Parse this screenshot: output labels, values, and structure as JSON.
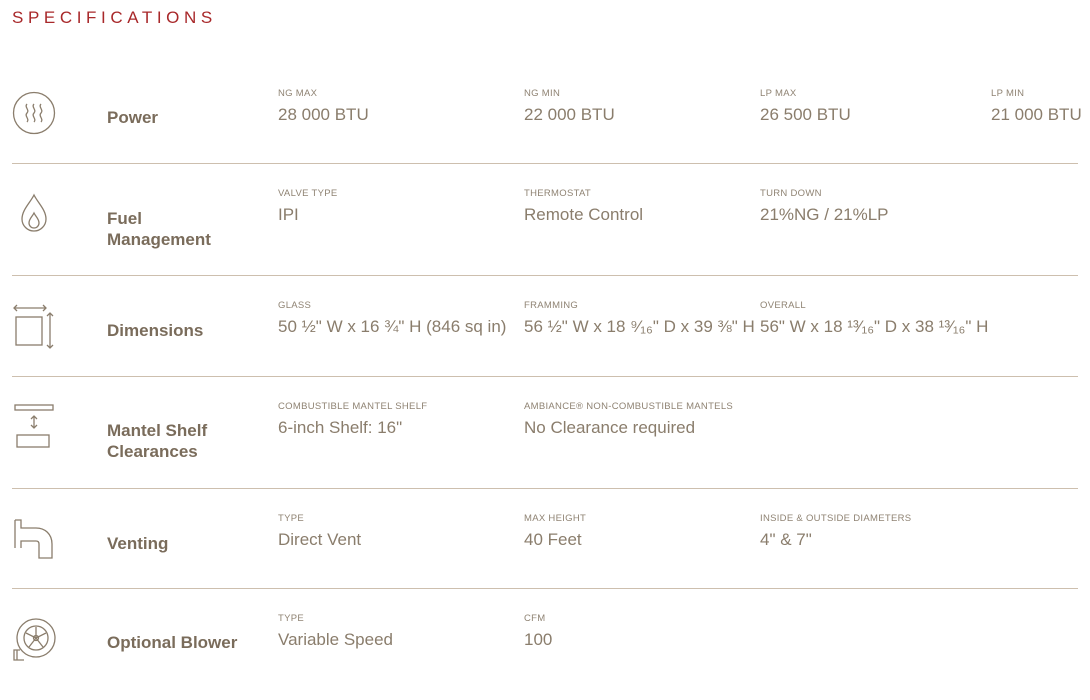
{
  "page": {
    "heading": "SPECIFICATIONS"
  },
  "rows": [
    {
      "icon": "heat-waves-icon",
      "label_lines": [
        "Power"
      ],
      "fields": [
        {
          "caption": "NG MAX",
          "value": "28 000 BTU"
        },
        {
          "caption": "NG MIN",
          "value": "22 000 BTU"
        },
        {
          "caption": "LP MAX",
          "value": "26 500 BTU"
        },
        {
          "caption": "LP MIN",
          "value": "21 000 BTU"
        }
      ]
    },
    {
      "icon": "flame-drop-icon",
      "label_lines": [
        "Fuel",
        "Management"
      ],
      "fields": [
        {
          "caption": "VALVE TYPE",
          "value": "IPI"
        },
        {
          "caption": "THERMOSTAT",
          "value": "Remote Control"
        },
        {
          "caption": "TURN DOWN",
          "value": "21%NG / 21%LP"
        }
      ]
    },
    {
      "icon": "dimensions-icon",
      "label_lines": [
        "Dimensions"
      ],
      "fields": [
        {
          "caption": "GLASS",
          "value": "50 ½\" W x 16 ¾\" H (846 sq in)"
        },
        {
          "caption": "FRAMMING",
          "value": "56 ½\" W x 18 ⁹⁄₁₆\" D x 39 ⅜\" H"
        },
        {
          "caption": "OVERALL",
          "value": "56\" W x 18 ¹³⁄₁₆\" D x 38 ¹³⁄₁₆\" H"
        }
      ]
    },
    {
      "icon": "mantel-clearance-icon",
      "label_lines": [
        "Mantel Shelf",
        "Clearances"
      ],
      "fields": [
        {
          "caption": "COMBUSTIBLE MANTEL SHELF",
          "value": "6-inch Shelf: 16\""
        },
        {
          "caption": "AMBIANCE® NON-COMBUSTIBLE MANTELS",
          "value": "No Clearance required"
        }
      ]
    },
    {
      "icon": "vent-pipe-icon",
      "label_lines": [
        "Venting"
      ],
      "fields": [
        {
          "caption": "TYPE",
          "value": "Direct Vent"
        },
        {
          "caption": "MAX HEIGHT",
          "value": "40 Feet"
        },
        {
          "caption": "INSIDE & OUTSIDE DIAMETERS",
          "value": "4\" & 7\""
        }
      ]
    },
    {
      "icon": "blower-fan-icon",
      "label_lines": [
        "Optional Blower"
      ],
      "fields": [
        {
          "caption": "TYPE",
          "value": "Variable Speed"
        },
        {
          "caption": "CFM",
          "value": "100"
        }
      ]
    }
  ]
}
